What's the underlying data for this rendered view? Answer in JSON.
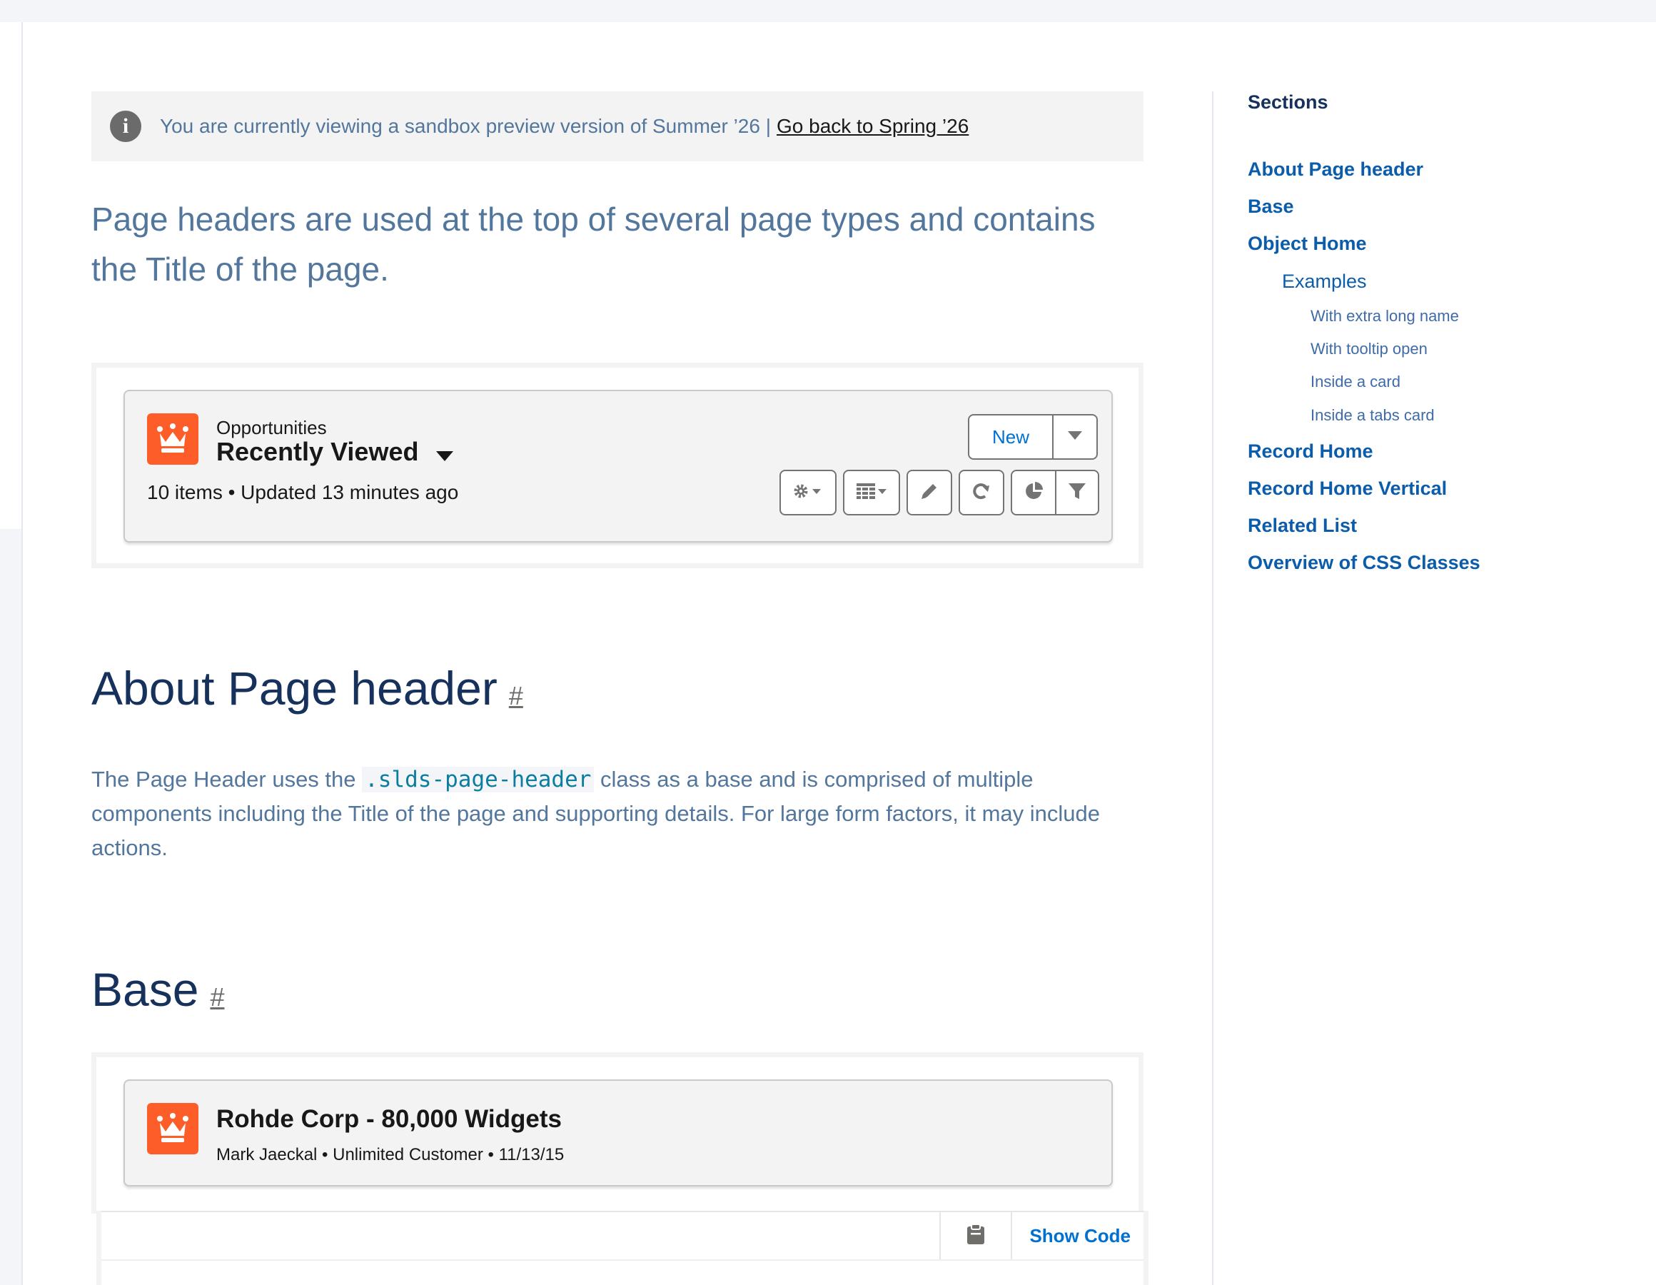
{
  "notice": {
    "text": "You are currently viewing a sandbox preview version of Summer ’26 |",
    "link": "Go back to Spring ’26"
  },
  "intro": "Page headers are used at the top of several page types and contains the Title of the page.",
  "example1": {
    "object": "Opportunities",
    "title": "Recently Viewed",
    "meta": "10 items • Updated 13 minutes ago",
    "new_label": "New",
    "icons": [
      "crown-icon",
      "chevron-down-icon",
      "gear-icon",
      "table-icon",
      "pencil-icon",
      "refresh-icon",
      "chart-icon",
      "filter-icon"
    ]
  },
  "about": {
    "heading": "About Page header",
    "hash": "#",
    "text_before": "The Page Header uses the ",
    "code": ".slds-page-header",
    "text_after": " class as a base and is comprised of multiple components including the Title of the page and supporting details. For large form factors, it may include actions."
  },
  "base": {
    "heading": "Base",
    "hash": "#",
    "title": "Rohde Corp - 80,000 Widgets",
    "meta": "Mark Jaeckal • Unlimited Customer • 11/13/15",
    "show_code": "Show Code",
    "icons": [
      "crown-icon",
      "clipboard-icon"
    ]
  },
  "sidebar": {
    "heading": "Sections",
    "items": [
      {
        "label": "About Page header",
        "level": 1
      },
      {
        "label": "Base",
        "level": 1
      },
      {
        "label": "Object Home",
        "level": 1
      },
      {
        "label": "Examples",
        "level": 2
      },
      {
        "label": "With extra long name",
        "level": 3
      },
      {
        "label": "With tooltip open",
        "level": 3
      },
      {
        "label": "Inside a card",
        "level": 3
      },
      {
        "label": "Inside a tabs card",
        "level": 3
      },
      {
        "label": "Record Home",
        "level": 1
      },
      {
        "label": "Record Home Vertical",
        "level": 1
      },
      {
        "label": "Related List",
        "level": 1
      },
      {
        "label": "Overview of CSS Classes",
        "level": 1
      }
    ]
  },
  "colors": {
    "brand_icon": "#fc5d29",
    "link": "#0070d2",
    "heading": "#16325c",
    "body_text": "#53769c"
  }
}
